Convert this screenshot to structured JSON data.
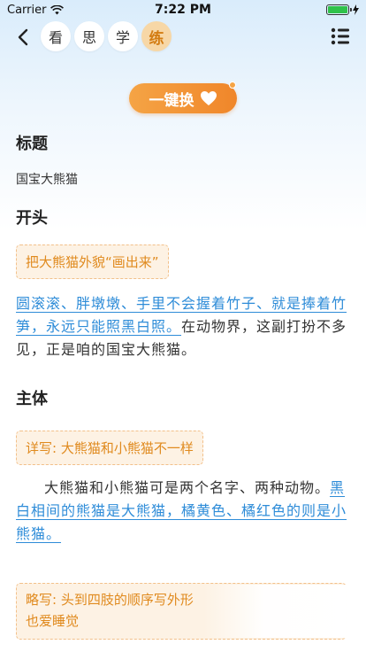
{
  "status_bar": {
    "carrier": "Carrier",
    "time": "7:22 PM",
    "battery_level": 1.0
  },
  "nav": {
    "back_icon": "chevron-left-icon",
    "tabs": [
      {
        "label": "看",
        "active": false
      },
      {
        "label": "思",
        "active": false
      },
      {
        "label": "学",
        "active": false
      },
      {
        "label": "练",
        "active": true
      }
    ],
    "menu_icon": "list-menu-icon"
  },
  "swap_button": {
    "label": "一键换",
    "icon": "heart-icon"
  },
  "sections": {
    "title_heading": "标题",
    "title_value": "国宝大熊猫",
    "opening_heading": "开头",
    "opening_tip": "把大熊猫外貌“画出来”",
    "opening_link": "圆滚滚、胖墩墩、手里不会握着竹子、就是捧着竹笋，永远只能照黑白照。",
    "opening_rest": "在动物界，这副打扮不多见，正是咱的国宝大熊猫。",
    "body_heading": "主体",
    "body_tip": "详写: 大熊猫和小熊猫不一样",
    "body_text": "大熊猫和小熊猫可是两个名字、两种动物。",
    "body_link": "黑白相间的熊猫是大熊猫，橘黄色、橘红色的则是小熊猫。",
    "brief_tip": "略写: 头到四肢的顺序写外形",
    "brief_tip_line2": "也爱睡觉"
  },
  "colors": {
    "accent_orange": "#f0862a",
    "link_blue": "#2e8cd8",
    "tip_text": "#e08a1e",
    "tip_bg": "#fdf2e4"
  }
}
